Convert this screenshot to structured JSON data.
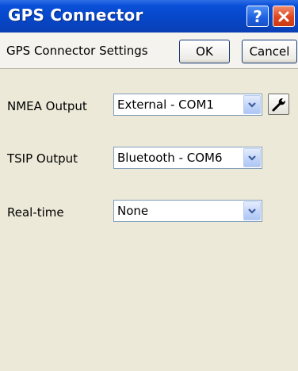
{
  "window": {
    "title": "GPS Connector",
    "help_glyph": "?",
    "close_glyph": "close-icon"
  },
  "commandbar": {
    "title": "GPS Connector Settings",
    "ok_label": "OK",
    "cancel_label": "Cancel"
  },
  "settings": {
    "nmea": {
      "label": "NMEA Output",
      "value": "External - COM1"
    },
    "tsip": {
      "label": "TSIP Output",
      "value": "Bluetooth - COM6"
    },
    "realtime": {
      "label": "Real-time",
      "value": "None"
    }
  },
  "icons": {
    "dropdown": "chevron-down-icon",
    "configure": "wrench-icon"
  },
  "colors": {
    "titlebar": "#0647c9",
    "close_button": "#e0461e",
    "background": "#ece9d8"
  }
}
